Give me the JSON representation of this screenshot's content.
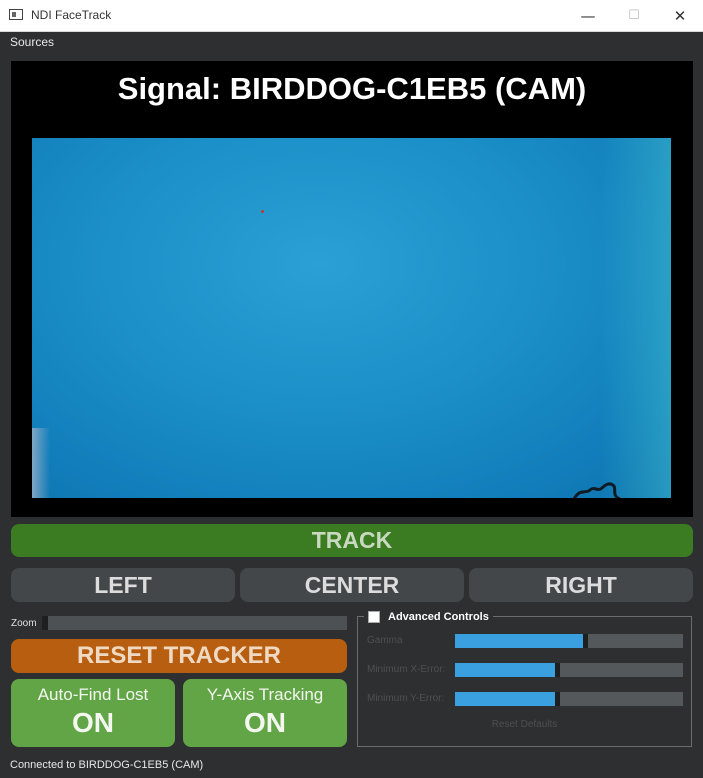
{
  "window": {
    "title": "NDI FaceTrack",
    "minimize_glyph": "—",
    "maximize_glyph": "☐",
    "close_glyph": "✕"
  },
  "menu": {
    "sources": "Sources"
  },
  "video": {
    "signal_title": "Signal: BIRDDOG-C1EB5 (CAM)"
  },
  "controls": {
    "track": "TRACK",
    "left": "LEFT",
    "center": "CENTER",
    "right": "RIGHT",
    "zoom_label": "Zoom",
    "zoom_level": 0,
    "reset_tracker": "RESET TRACKER",
    "auto_find": {
      "label": "Auto-Find Lost",
      "state": "ON"
    },
    "y_axis": {
      "label": "Y-Axis Tracking",
      "state": "ON"
    }
  },
  "advanced": {
    "title": "Advanced Controls",
    "checked": false,
    "sliders": [
      {
        "label": "Gamma",
        "value": 0.56
      },
      {
        "label": "Minimum X-Error:",
        "value": 0.44
      },
      {
        "label": "Minimum Y-Error:",
        "value": 0.44
      }
    ],
    "reset_defaults": "Reset Defaults"
  },
  "status": {
    "text": "Connected to BIRDDOG-C1EB5 (CAM)"
  },
  "colors": {
    "track": "#3b7c22",
    "reset": "#b85e10",
    "toggle": "#62a546",
    "slider_fill": "#3aa0e0",
    "camera": "#1b8fc7"
  }
}
